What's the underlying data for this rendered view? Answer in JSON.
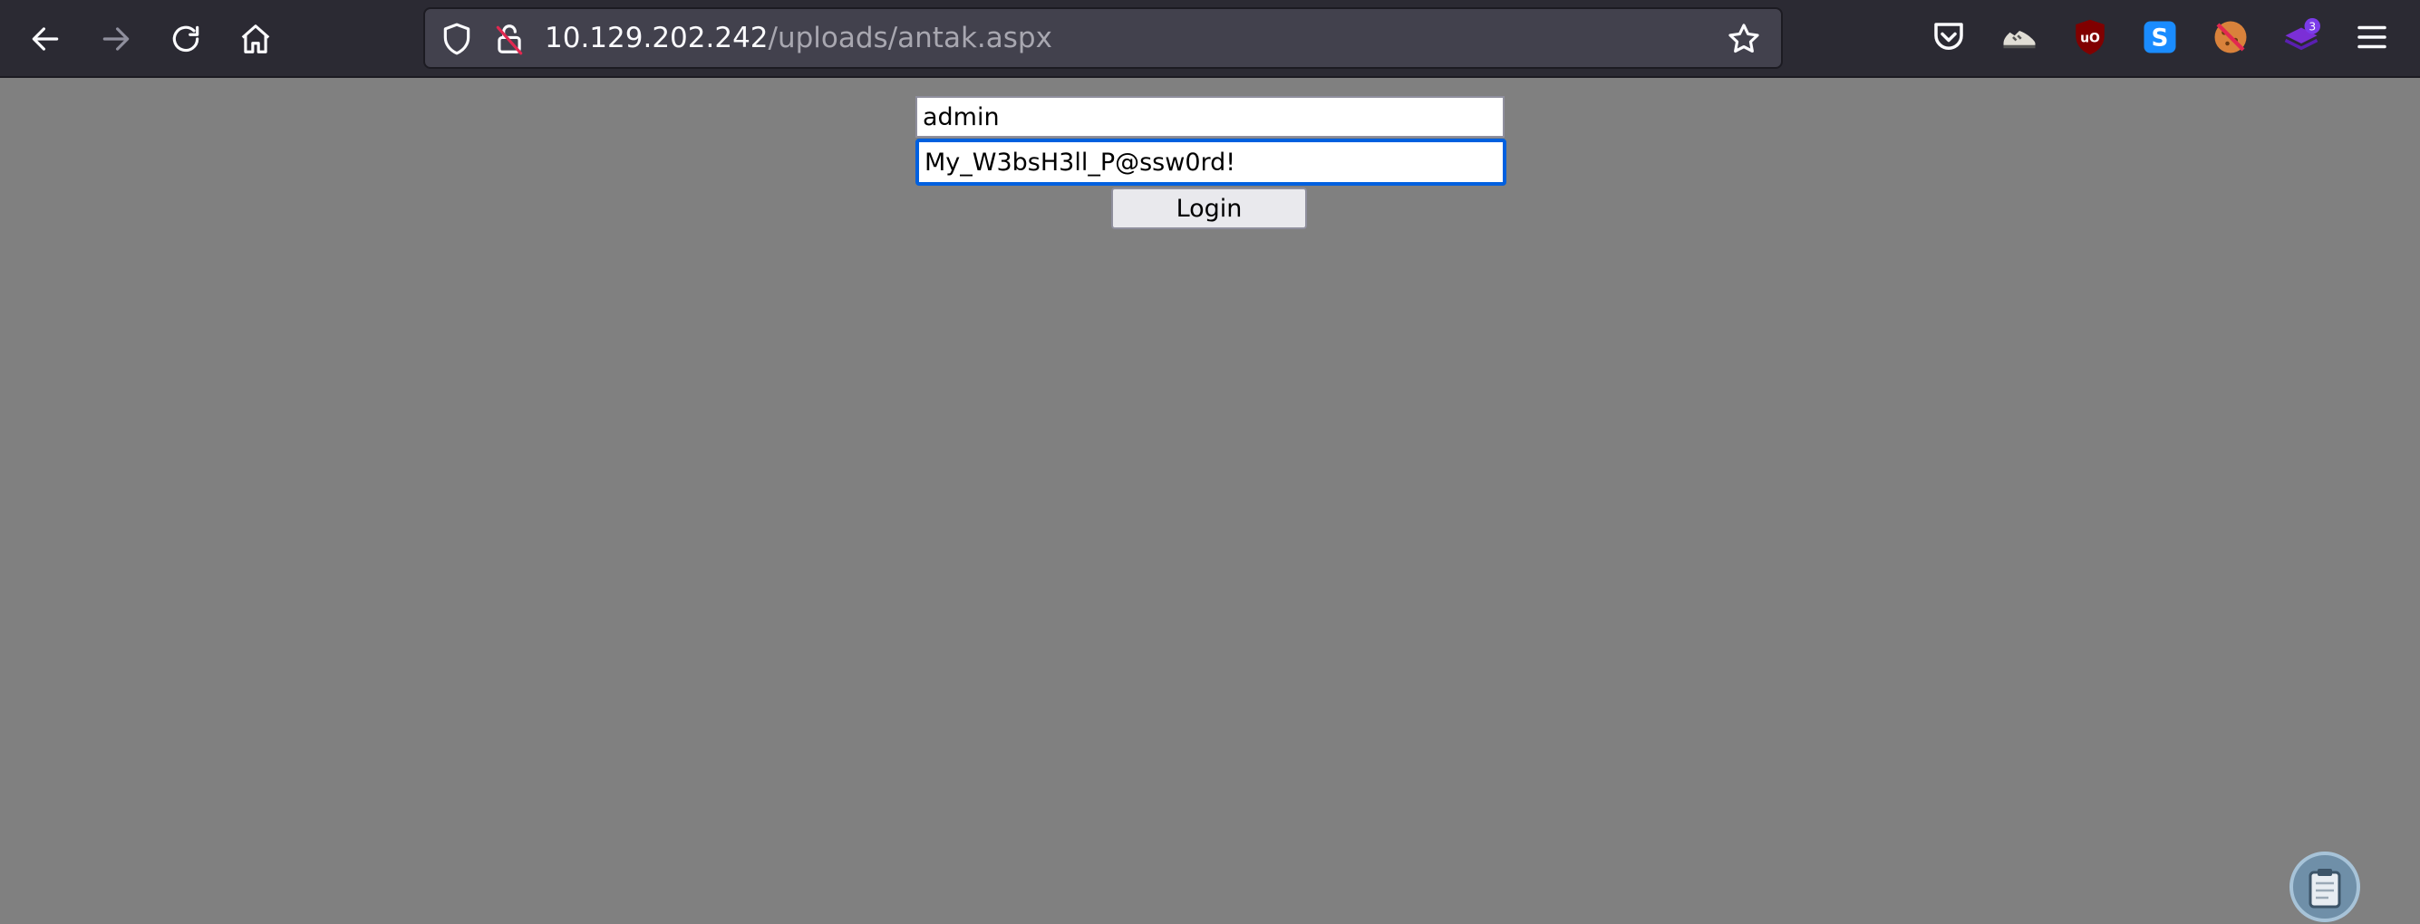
{
  "browser": {
    "url_host": "10.129.202.242",
    "url_path": "/uploads/antak.aspx",
    "extension_badge_count": "3"
  },
  "login": {
    "username_value": "admin",
    "password_value": "My_W3bsH3ll_P@ssw0rd!",
    "button_label": "Login"
  },
  "colors": {
    "page_background": "#808080",
    "toolbar_background": "#2b2a33",
    "focus_ring": "#0060df"
  }
}
